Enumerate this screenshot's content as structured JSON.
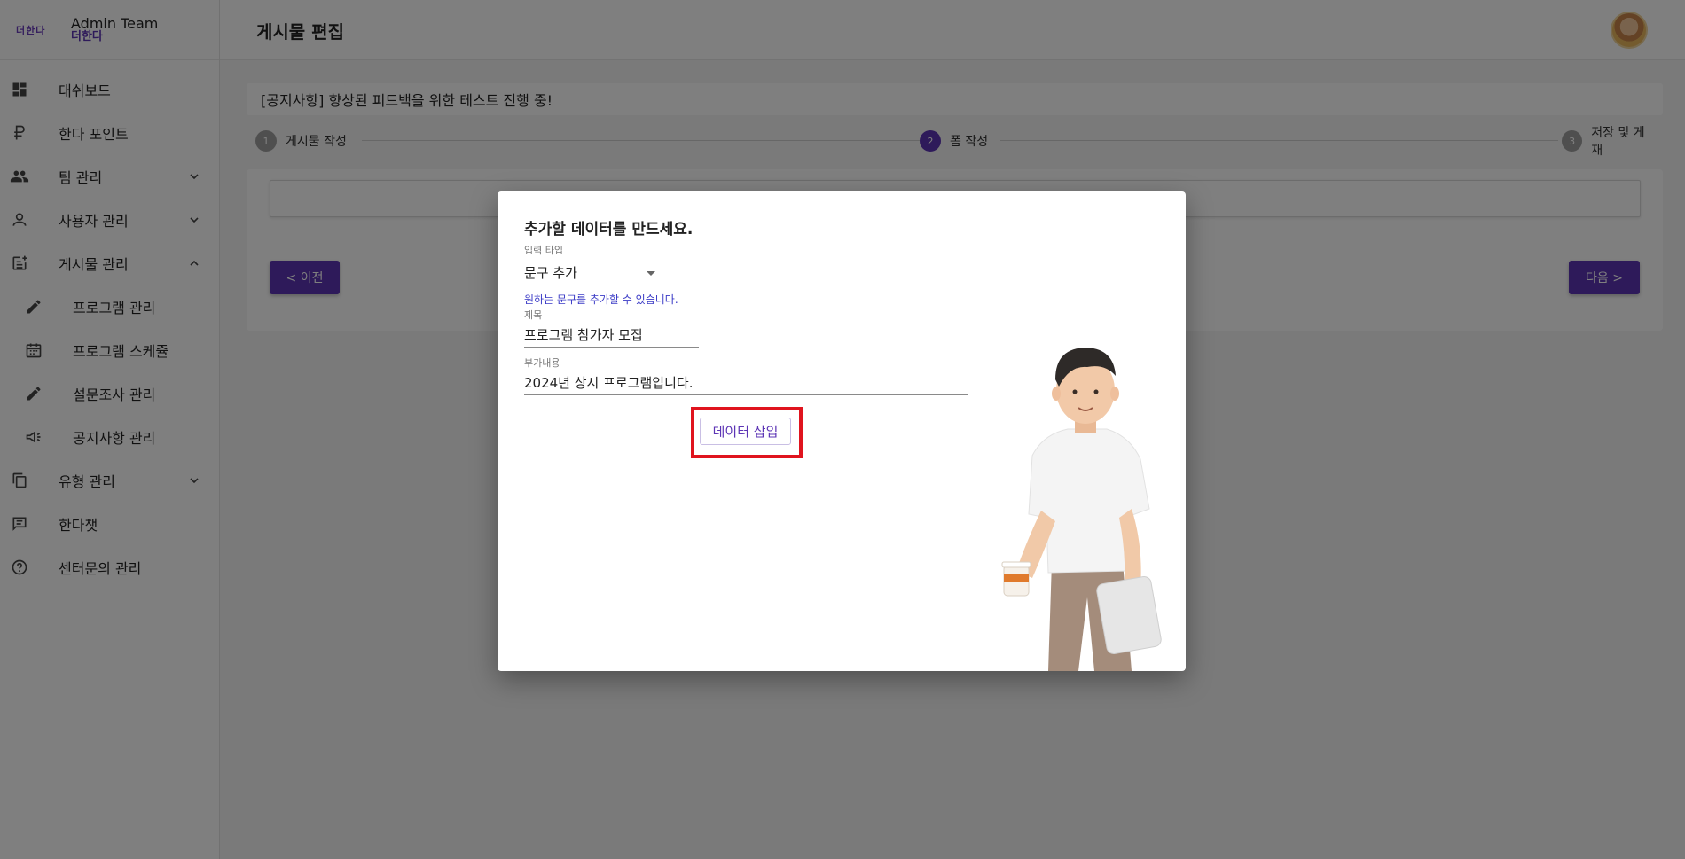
{
  "brand": {
    "logo": "더한다",
    "title": "Admin Team",
    "subtitle": "더한다"
  },
  "sidebar": {
    "items": [
      {
        "label": "대쉬보드",
        "icon": "dashboard-icon"
      },
      {
        "label": "한다 포인트",
        "icon": "ruble-icon"
      },
      {
        "label": "팀 관리",
        "icon": "people-icon"
      },
      {
        "label": "사용자 관리",
        "icon": "person-icon"
      },
      {
        "label": "게시물 관리",
        "icon": "post-add-icon"
      },
      {
        "label": "프로그램 관리",
        "icon": "pencil-icon"
      },
      {
        "label": "프로그램 스케쥴",
        "icon": "calendar-icon"
      },
      {
        "label": "설문조사 관리",
        "icon": "pencil-icon"
      },
      {
        "label": "공지사항 관리",
        "icon": "megaphone-icon"
      },
      {
        "label": "유형 관리",
        "icon": "copy-icon"
      },
      {
        "label": "한다챗",
        "icon": "chat-icon"
      },
      {
        "label": "센터문의 관리",
        "icon": "help-icon"
      }
    ]
  },
  "header": {
    "title": "게시물 편집"
  },
  "notice": {
    "text": "[공지사항] 향상된 피드백을 위한 테스트 진행 중!"
  },
  "stepper": {
    "steps": [
      {
        "num": "1",
        "label": "게시물 작성"
      },
      {
        "num": "2",
        "label": "폼 작성"
      },
      {
        "num": "3",
        "label": "저장 및 게재"
      }
    ],
    "active_index": 2
  },
  "card": {
    "prev_label": "< 이전",
    "next_label": "다음 >"
  },
  "modal": {
    "title": "추가할 데이터를 만드세요.",
    "input_type_label": "입력 타입",
    "input_type_value": "문구 추가",
    "helper_text": "원하는 문구를 추가할 수 있습니다.",
    "title_label": "제목",
    "title_value": "프로그램 참가자 모집",
    "extra_label": "부가내용",
    "extra_value": "2024년 상시 프로그램입니다.",
    "insert_button": "데이터 삽입"
  },
  "colors": {
    "accent": "#5c34b5",
    "highlight": "#e0141e",
    "helper": "#3a3ac6"
  }
}
